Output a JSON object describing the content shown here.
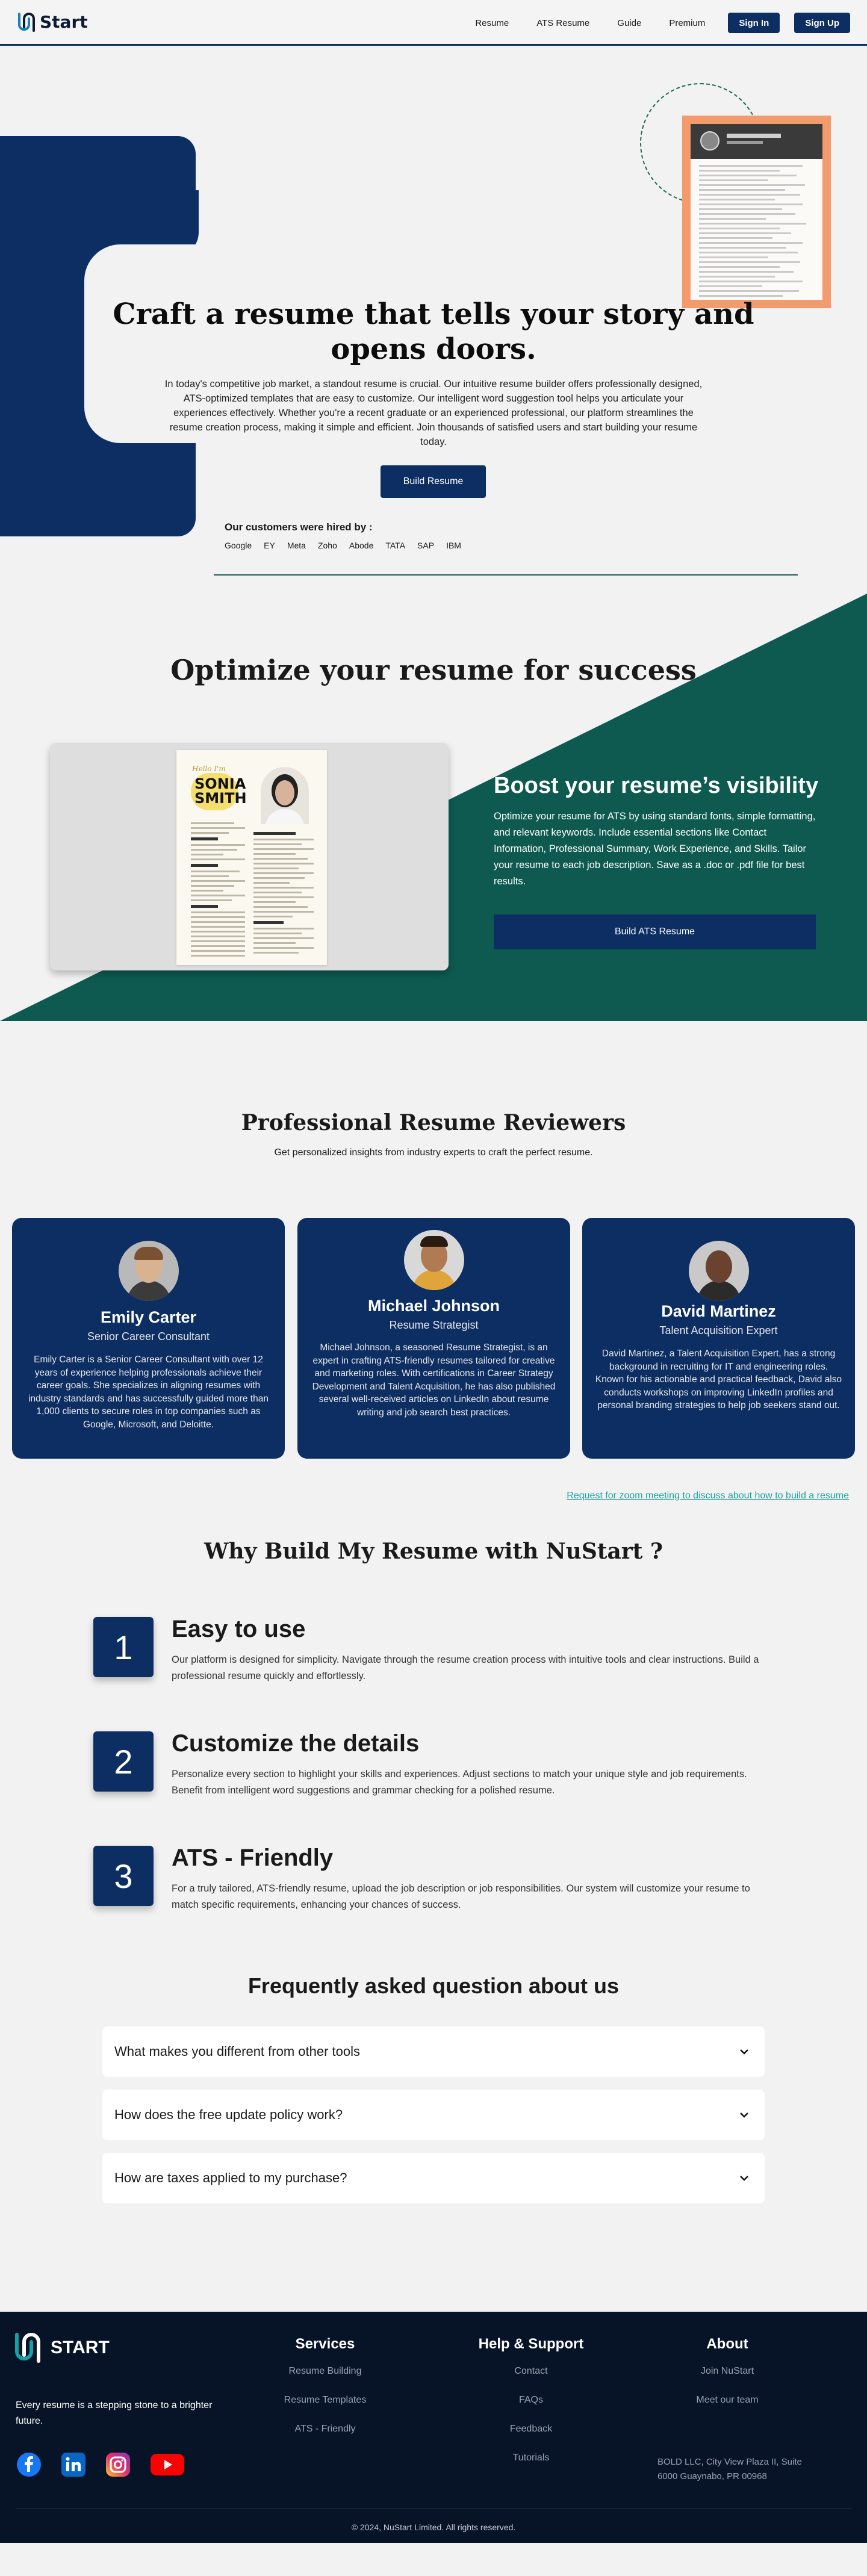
{
  "nav": {
    "logo_text": "Start",
    "links": [
      "Resume",
      "ATS Resume",
      "Guide",
      "Premium"
    ],
    "sign_in": "Sign In",
    "sign_up": "Sign Up"
  },
  "hero": {
    "title": "Craft a resume that tells your story and opens doors.",
    "description": "In today's competitive job market, a standout resume is crucial. Our intuitive resume builder offers professionally designed, ATS-optimized templates that are easy to customize. Our intelligent word suggestion tool helps you articulate your experiences effectively. Whether you're a recent graduate or an experienced professional, our platform streamlines the resume creation process, making it simple and efficient. Join thousands of satisfied users and start building your resume today.",
    "cta": "Build Resume",
    "hired_title": "Our customers were hired by :",
    "companies": [
      "Google",
      "EY",
      "Meta",
      "Zoho",
      "Abode",
      "TATA",
      "SAP",
      "IBM"
    ]
  },
  "optimize": {
    "title": "Optimize your resume for success",
    "cv_hello": "Hello I'm",
    "cv_first": "SONIA",
    "cv_last": "SMITH",
    "boost_title": "Boost your resume’s visibility",
    "boost_text": "Optimize your resume for ATS by using standard fonts, simple formatting, and relevant keywords. Include essential sections like Contact Information, Professional Summary, Work Experience, and Skills. Tailor your resume to each job description. Save as a .doc or .pdf file for best results.",
    "cta": "Build ATS Resume"
  },
  "reviewers": {
    "title": "Professional Resume Reviewers",
    "subtitle": "Get personalized insights from industry experts to craft the perfect resume.",
    "people": [
      {
        "name": "Emily Carter",
        "role": "Senior Career Consultant",
        "bio": "Emily Carter is a Senior Career Consultant with over 12 years of experience helping professionals achieve their career goals. She specializes in aligning resumes with industry standards and has successfully guided more than 1,000 clients to secure roles in top companies such as Google, Microsoft, and Deloitte."
      },
      {
        "name": "Michael Johnson",
        "role": "Resume Strategist",
        "bio": "Michael Johnson, a seasoned Resume Strategist, is an expert in crafting ATS-friendly resumes tailored for creative and marketing roles. With certifications in Career Strategy Development and Talent Acquisition, he has also published several well-received articles on LinkedIn about resume writing and job search best practices."
      },
      {
        "name": "David Martinez",
        "role": "Talent Acquisition Expert",
        "bio": "David Martinez, a Talent Acquisition Expert, has a strong background in recruiting for IT and engineering roles. Known for his actionable and practical feedback, David also conducts workshops on improving LinkedIn profiles and personal branding strategies to help job seekers stand out."
      }
    ],
    "zoom_link": "Request for zoom meeting to discuss about how to build a resume"
  },
  "why": {
    "title": "Why Build My Resume with NuStart ?",
    "items": [
      {
        "num": "1",
        "title": "Easy to use",
        "text": "Our platform is designed for simplicity. Navigate through the resume creation process with intuitive tools and clear instructions. Build a professional resume quickly and effortlessly."
      },
      {
        "num": "2",
        "title": "Customize the details",
        "text": "Personalize every section to highlight your skills and experiences. Adjust sections to match your unique style and job requirements. Benefit from intelligent word suggestions and grammar checking for a polished resume."
      },
      {
        "num": "3",
        "title": "ATS - Friendly",
        "text": "For a truly tailored, ATS-friendly resume, upload the job description or job responsibilities. Our system will customize your resume to match specific requirements, enhancing your chances of success."
      }
    ]
  },
  "faq": {
    "title": "Frequently asked question about us",
    "items": [
      "What makes you different from other tools",
      "How does the free update policy work?",
      "How are taxes applied to my purchase?"
    ]
  },
  "footer": {
    "logo_text": "START",
    "tagline": "Every resume is a stepping stone to a brighter future.",
    "services_title": "Services",
    "services": [
      "Resume Building",
      "Resume Templates",
      "ATS - Friendly"
    ],
    "help_title": "Help & Support",
    "help": [
      "Contact",
      "FAQs",
      "Feedback",
      "Tutorials"
    ],
    "about_title": "About",
    "about": [
      "Join NuStart",
      "Meet our team"
    ],
    "address": "BOLD LLC, City View Plaza II, Suite 6000 Guaynabo, PR 00968",
    "copyright": "© 2024, NuStart Limited. All rights reserved."
  },
  "colors": {
    "primary": "#0c2e63",
    "teal": "#0e5a50",
    "accent_orange": "#f39b6d",
    "footer_bg": "#071327"
  }
}
